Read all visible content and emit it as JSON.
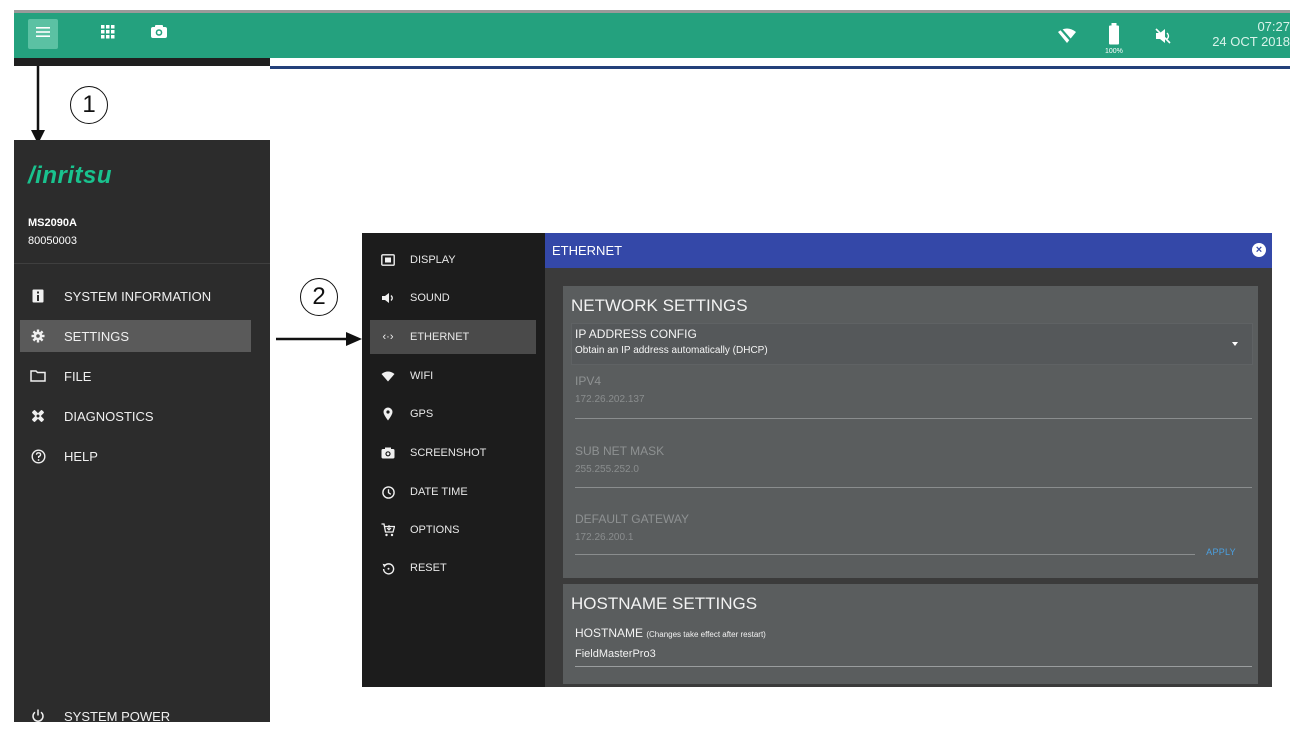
{
  "topbar": {
    "icons": [
      "menu-icon",
      "apps-grid-icon",
      "camera-icon",
      "wifi-off-icon",
      "battery-icon",
      "mute-icon"
    ],
    "battery_pct": "100%",
    "time": "07:27",
    "date": "24 OCT 2018",
    "color": "#24a17e"
  },
  "drawer": {
    "logo": "/inritsu",
    "model": "MS2090A",
    "serial": "80050003",
    "items": [
      {
        "label": "SYSTEM INFORMATION",
        "icon": "info-icon"
      },
      {
        "label": "SETTINGS",
        "icon": "gear-icon"
      },
      {
        "label": "FILE",
        "icon": "folder-icon"
      },
      {
        "label": "DIAGNOSTICS",
        "icon": "diagnostics-icon"
      },
      {
        "label": "HELP",
        "icon": "help-icon"
      }
    ],
    "selected": "SETTINGS",
    "power": "SYSTEM POWER"
  },
  "annotations": {
    "step1": "1",
    "step2": "2"
  },
  "settings": {
    "items": [
      {
        "label": "DISPLAY",
        "icon": "display-icon"
      },
      {
        "label": "SOUND",
        "icon": "speaker-icon"
      },
      {
        "label": "ETHERNET",
        "icon": "ethernet-icon"
      },
      {
        "label": "WIFI",
        "icon": "wifi-icon"
      },
      {
        "label": "GPS",
        "icon": "location-pin-icon"
      },
      {
        "label": "SCREENSHOT",
        "icon": "camera-icon"
      },
      {
        "label": "DATE TIME",
        "icon": "clock-icon"
      },
      {
        "label": "OPTIONS",
        "icon": "cart-icon"
      },
      {
        "label": "RESET",
        "icon": "reset-icon"
      }
    ],
    "selected": "ETHERNET"
  },
  "ethernet": {
    "title": "ETHERNET",
    "header_color": "#3448a8",
    "network": {
      "title": "NETWORK SETTINGS",
      "ip_config_label": "IP ADDRESS CONFIG",
      "ip_config_value": "Obtain an IP address automatically (DHCP)",
      "ipv4_label": "IPV4",
      "ipv4_value": "172.26.202.137",
      "subnet_label": "SUB NET MASK",
      "subnet_value": "255.255.252.0",
      "gateway_label": "DEFAULT GATEWAY",
      "gateway_value": "172.26.200.1",
      "apply": "APPLY"
    },
    "hostname": {
      "title": "HOSTNAME SETTINGS",
      "label": "HOSTNAME",
      "note": "(Changes take effect after restart)",
      "value": "FieldMasterPro3"
    }
  }
}
